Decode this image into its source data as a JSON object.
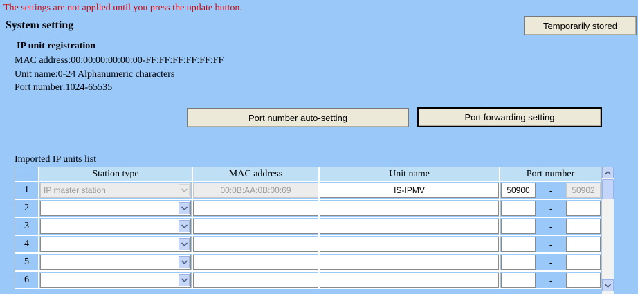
{
  "warning": "The settings are not applied until you press the update button.",
  "system_title": "System setting",
  "temporarily_stored_label": "Temporarily stored",
  "registration": {
    "title": "IP unit registration",
    "mac_info": "MAC address:00:00:00:00:00:00-FF:FF:FF:FF:FF:FF",
    "name_info": "Unit name:0-24 Alphanumeric characters",
    "port_info": "Port number:1024-65535"
  },
  "port_auto_label": "Port number auto-setting",
  "port_forwarding_label": "Port forwarding setting",
  "list_title": "Imported IP units list",
  "columns": {
    "station_type": "Station type",
    "mac_address": "MAC address",
    "unit_name": "Unit name",
    "port_number": "Port number"
  },
  "rows": [
    {
      "no": "1",
      "station_type": "IP master station",
      "mac": "00:0B:AA:0B:00:69",
      "unit_name": "IS-IPMV",
      "port_start": "50900",
      "sep": "-",
      "port_end": "50902"
    },
    {
      "no": "2",
      "station_type": "",
      "mac": "",
      "unit_name": "",
      "port_start": "",
      "sep": "-",
      "port_end": ""
    },
    {
      "no": "3",
      "station_type": "",
      "mac": "",
      "unit_name": "",
      "port_start": "",
      "sep": "-",
      "port_end": ""
    },
    {
      "no": "4",
      "station_type": "",
      "mac": "",
      "unit_name": "",
      "port_start": "",
      "sep": "-",
      "port_end": ""
    },
    {
      "no": "5",
      "station_type": "",
      "mac": "",
      "unit_name": "",
      "port_start": "",
      "sep": "-",
      "port_end": ""
    },
    {
      "no": "6",
      "station_type": "",
      "mac": "",
      "unit_name": "",
      "port_start": "",
      "sep": "-",
      "port_end": ""
    }
  ],
  "colors": {
    "background": "#99c8f9",
    "warning": "#e00000",
    "header": "#bfe0f4"
  }
}
